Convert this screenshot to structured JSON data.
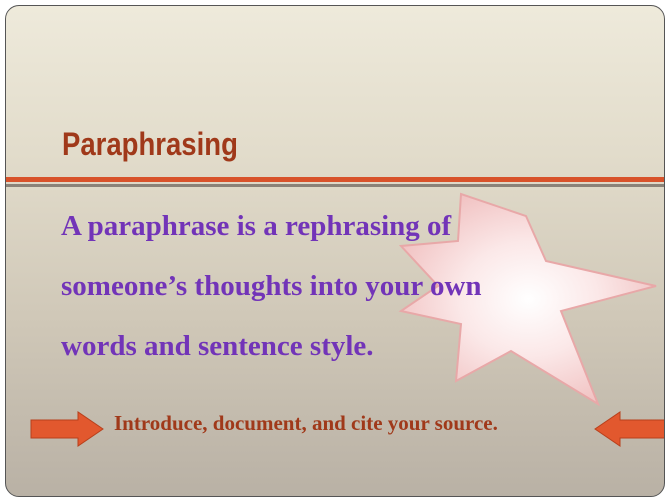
{
  "slide": {
    "title": "Paraphrasing",
    "body_lines": [
      "A paraphrase is a rephrasing of",
      "someone’s  thoughts  into  your own",
      "words and sentence style."
    ],
    "footer_note": "Introduce, document, and cite your source."
  },
  "colors": {
    "title": "#a0391a",
    "body_text": "#7234b8",
    "accent_rule": "#d8522a",
    "arrow_fill": "#e2582e",
    "starburst_fill": "#f7d8d8",
    "starburst_stroke": "#e8a8a8"
  },
  "icons": {
    "decoration": "starburst-icon",
    "left_arrow": "arrow-right-icon",
    "right_arrow": "arrow-left-icon"
  }
}
